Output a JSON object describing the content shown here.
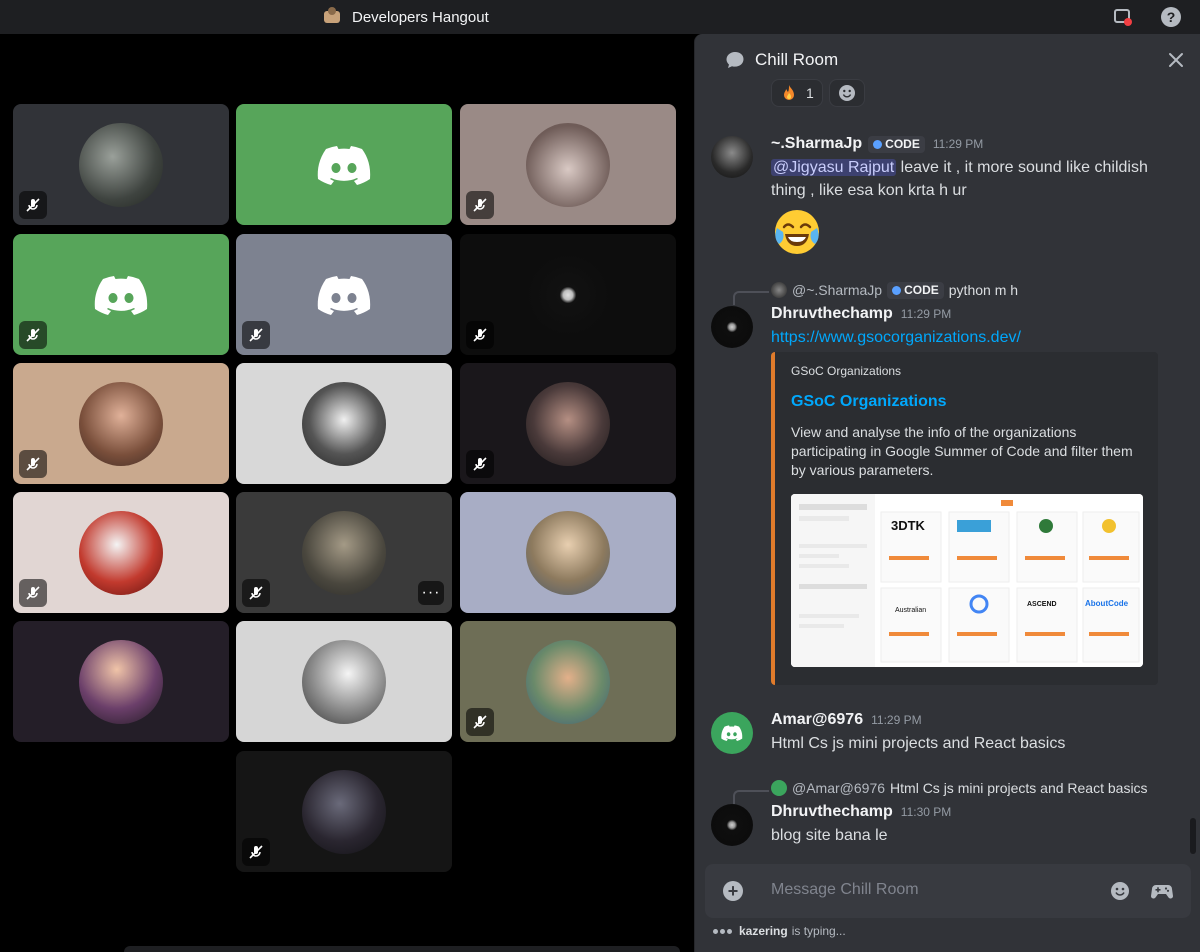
{
  "window": {
    "title": "Developers Hangout"
  },
  "chat": {
    "channel_name": "Chill Room",
    "reactions": [
      {
        "emoji": "fire",
        "count": "1"
      },
      {
        "emoji": "add-reaction",
        "count": ""
      }
    ],
    "messages": [
      {
        "author": "~.SharmaJp",
        "tag": "CODE",
        "time": "11:29 PM",
        "mention": "@Jigyasu Rajput",
        "text": " leave it , it more sound like childish thing , like esa kon krta h ur"
      },
      {
        "reply_to": "@~.SharmaJp",
        "reply_tag": "CODE",
        "reply_text": "python m h",
        "author": "Dhruvthechamp",
        "time": "11:29 PM",
        "link": "https://www.gsocorganizations.dev/",
        "embed": {
          "provider": "GSoC Organizations",
          "title": "GSoC Organizations",
          "description": "View and analyse the info of the organizations participating in Google Summer of Code and filter them by various parameters."
        }
      },
      {
        "author": "Amar@6976",
        "time": "11:29 PM",
        "text": "Html Cs js mini projects  and React basics"
      },
      {
        "reply_to": "@Amar@6976",
        "reply_text": "Html Cs js mini projects  and React basics",
        "author": "Dhruvthechamp",
        "time": "11:30 PM",
        "text": "blog site bana le"
      }
    ],
    "composer": {
      "placeholder": "Message Chill Room"
    },
    "typing": {
      "user": "kazering",
      "suffix": "is typing..."
    }
  },
  "video_tiles": [
    {
      "bg": "#313338",
      "muted": true
    },
    {
      "bg": "#57a55a",
      "muted": false,
      "discord_default": true
    },
    {
      "bg": "#9a8a86",
      "muted": true
    },
    {
      "bg": "#57a55a",
      "muted": true,
      "discord_default": true
    },
    {
      "bg": "#7d8290",
      "muted": true,
      "discord_default": true
    },
    {
      "bg": "#0d0d0d",
      "muted": true
    },
    {
      "bg": "#c9a98e",
      "muted": true
    },
    {
      "bg": "#d8d8d8",
      "muted": false
    },
    {
      "bg": "#1a171b",
      "muted": true
    },
    {
      "bg": "#e1d6d3",
      "muted": true
    },
    {
      "bg": "#3a3a3a",
      "muted": true,
      "more": true
    },
    {
      "bg": "#a8adc5",
      "muted": false
    },
    {
      "bg": "#241e28",
      "muted": false
    },
    {
      "bg": "#d6d6d6",
      "muted": false
    },
    {
      "bg": "#6e6e56",
      "muted": true
    },
    {
      "bg": "#151515",
      "muted": true
    }
  ]
}
